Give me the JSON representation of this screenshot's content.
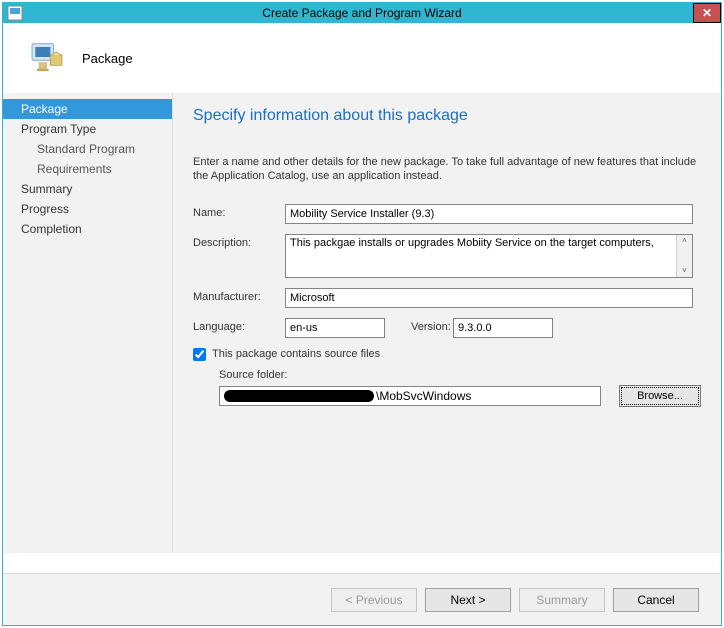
{
  "window": {
    "title": "Create Package and Program Wizard"
  },
  "header": {
    "title": "Package"
  },
  "sidebar": {
    "items": [
      {
        "label": "Package",
        "selected": true,
        "child": false
      },
      {
        "label": "Program Type",
        "selected": false,
        "child": false
      },
      {
        "label": "Standard Program",
        "selected": false,
        "child": true
      },
      {
        "label": "Requirements",
        "selected": false,
        "child": true
      },
      {
        "label": "Summary",
        "selected": false,
        "child": false
      },
      {
        "label": "Progress",
        "selected": false,
        "child": false
      },
      {
        "label": "Completion",
        "selected": false,
        "child": false
      }
    ]
  },
  "content": {
    "title": "Specify information about this package",
    "intro": "Enter a name and other details for the new package. To take full advantage of new features that include the Application Catalog, use an application instead.",
    "name_label": "Name:",
    "name_value": "Mobility Service Installer (9.3)",
    "desc_label": "Description:",
    "desc_value": "This packgae installs or upgrades Mobiity Service on the target computers,",
    "manufacturer_label": "Manufacturer:",
    "manufacturer_value": "Microsoft",
    "language_label": "Language:",
    "language_value": "en-us",
    "version_label": "Version:",
    "version_value": "9.3.0.0",
    "checkbox_label": "This package contains source files",
    "checkbox_checked": true,
    "source_folder_label": "Source folder:",
    "source_folder_suffix": "\\MobSvcWindows",
    "browse_label": "Browse..."
  },
  "footer": {
    "previous": "< Previous",
    "next": "Next >",
    "summary": "Summary",
    "cancel": "Cancel"
  }
}
